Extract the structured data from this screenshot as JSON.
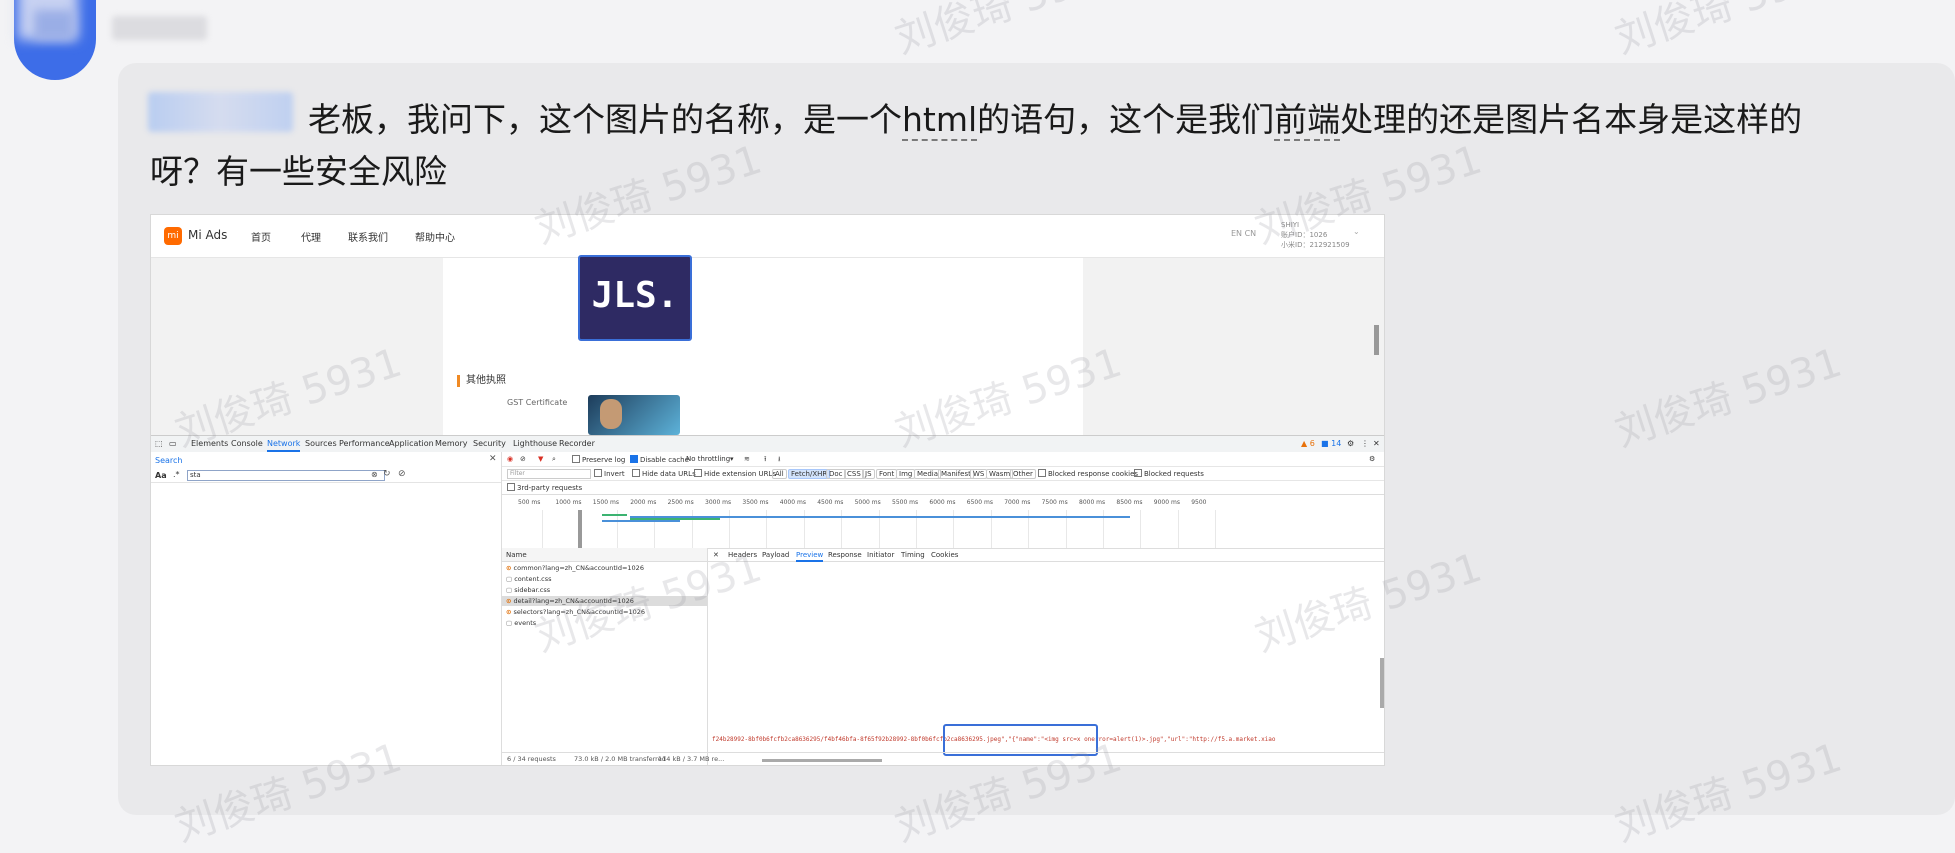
{
  "message": {
    "line1_a": "老板，我问下，这个图片的名称，是一个",
    "line1_u1": "html",
    "line1_b": "的语句，这个是我们",
    "line1_u2": "前端",
    "line1_c": "处理的还是图片名本身是这样的",
    "line2": "呀？有一些安全风险"
  },
  "watermark": "刘俊琦 5931",
  "site": {
    "logo": "mi",
    "brand": "Mi Ads",
    "nav": [
      "首页",
      "代理",
      "联系我们",
      "帮助中心"
    ],
    "lang": "EN  CN",
    "account_line1": "SHIYI",
    "account_line2": "账户ID：1026",
    "account_line3": "小米ID：212921509",
    "logo_text": "JLS.",
    "section_title": "其他执照",
    "gst_label": "GST Certificate"
  },
  "devtools": {
    "tabs": [
      "Elements",
      "Console",
      "Network",
      "Sources",
      "Performance",
      "Application",
      "Memory",
      "Security",
      "Lighthouse",
      "Recorder"
    ],
    "active_tab": "Network",
    "warn_count": "▲ 6",
    "msg_count": "■ 14",
    "search_title": "Search",
    "search_aa": "Aa",
    "search_dot": ".*",
    "search_value": "sta",
    "preserve_log": "Preserve log",
    "disable_cache": "Disable cache",
    "throttling": "No throttling",
    "filter_placeholder": "Filter",
    "invert": "Invert",
    "hide_data_urls": "Hide data URLs",
    "hide_ext_urls": "Hide extension URLs",
    "type_filters": [
      "All",
      "Fetch/XHR",
      "Doc",
      "CSS",
      "JS",
      "Font",
      "Img",
      "Media",
      "Manifest",
      "WS",
      "Wasm",
      "Other"
    ],
    "blocked_cookies": "Blocked response cookies",
    "blocked_requests": "Blocked requests",
    "third_party": "3rd-party requests",
    "timeline_ticks": [
      "500 ms",
      "1000 ms",
      "1500 ms",
      "2000 ms",
      "2500 ms",
      "3000 ms",
      "3500 ms",
      "4000 ms",
      "4500 ms",
      "5000 ms",
      "5500 ms",
      "6000 ms",
      "6500 ms",
      "7000 ms",
      "7500 ms",
      "8000 ms",
      "8500 ms",
      "9000 ms",
      "9500"
    ],
    "name_header": "Name",
    "requests": [
      "common?lang=zh_CN&accountId=1026",
      "content.css",
      "sidebar.css",
      "detail?lang=zh_CN&accountId=1026",
      "selectors?lang=zh_CN&accountId=1026",
      "events"
    ],
    "detail_tabs": [
      "Headers",
      "Payload",
      "Preview",
      "Response",
      "Initiator",
      "Timing",
      "Cookies"
    ],
    "active_detail_tab": "Preview",
    "response_text": "f24b28992-8bf0b6fcfb2ca8636295/f4bf46bfa-8f65f92b28992-8bf0b6fcfb2ca8636295.jpeg\",\"{\"name\":\"<img src=x onerror=alert(1)>.jpg\",\"url\":\"http://f5.a.market.xiao",
    "status_requests": "6 / 34 requests",
    "status_transferred": "73.0 kB / 2.0 MB transferred",
    "status_resources": "114 kB / 3.7 MB re..."
  }
}
